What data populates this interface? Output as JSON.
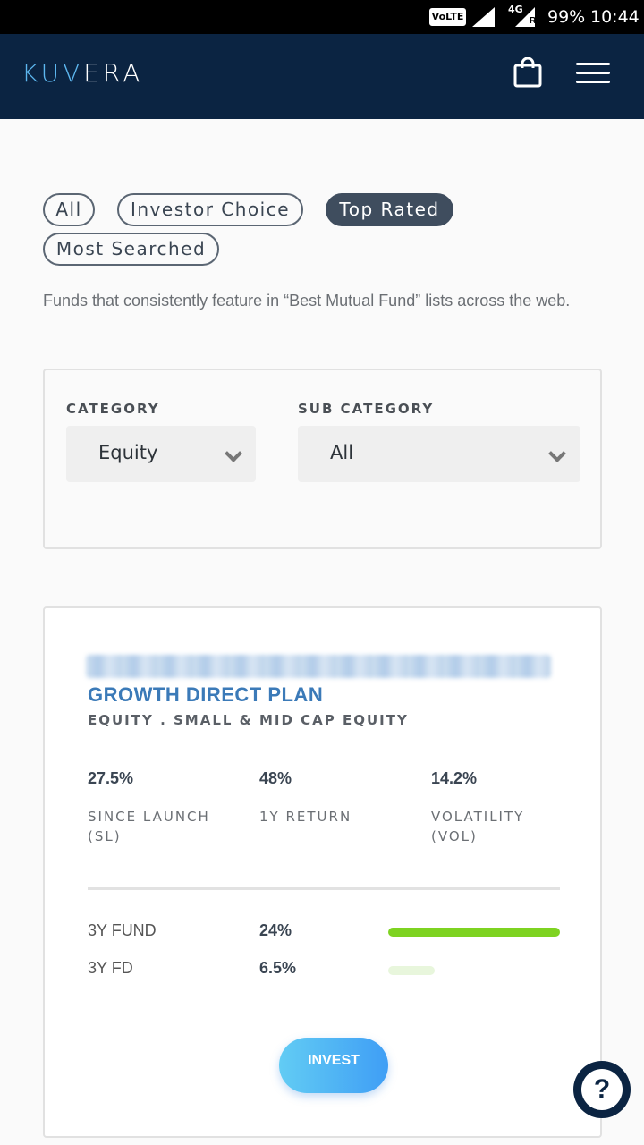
{
  "status_bar": {
    "volte": "VoLTE",
    "network": "4G",
    "roaming": "R",
    "battery": "99%",
    "time": "10:44"
  },
  "header": {
    "logo_part1": "KUV",
    "logo_part2": "ERA",
    "cart_icon": "shopping-bag-icon",
    "menu_icon": "hamburger-menu-icon"
  },
  "filters": {
    "chips": [
      {
        "label": "All",
        "active": false
      },
      {
        "label": "Investor Choice",
        "active": false
      },
      {
        "label": "Top Rated",
        "active": true
      },
      {
        "label": "Most Searched",
        "active": false
      }
    ],
    "description": "Funds that consistently feature in “Best Mutual Fund” lists across the web."
  },
  "filter_card": {
    "category_label": "CATEGORY",
    "category_value": "Equity",
    "subcategory_label": "SUB CATEGORY",
    "subcategory_value": "All"
  },
  "fund": {
    "title": "GROWTH DIRECT PLAN",
    "subtitle": "EQUITY . SMALL & MID CAP EQUITY",
    "stats": [
      {
        "value": "27.5%",
        "label": "SINCE LAUNCH (SL)"
      },
      {
        "value": "48%",
        "label": "1Y RETURN"
      },
      {
        "value": "14.2%",
        "label": "VOLATILITY (VOL)"
      }
    ],
    "comparison": [
      {
        "label": "3Y FUND",
        "value": "24%",
        "bar_fraction": 1.0,
        "bar_color": "#7ed321"
      },
      {
        "label": "3Y FD",
        "value": "6.5%",
        "bar_fraction": 0.27,
        "bar_color": "#e8f6dc"
      }
    ],
    "invest_label": "INVEST"
  },
  "help": {
    "icon": "help-question-icon",
    "label": "?"
  }
}
